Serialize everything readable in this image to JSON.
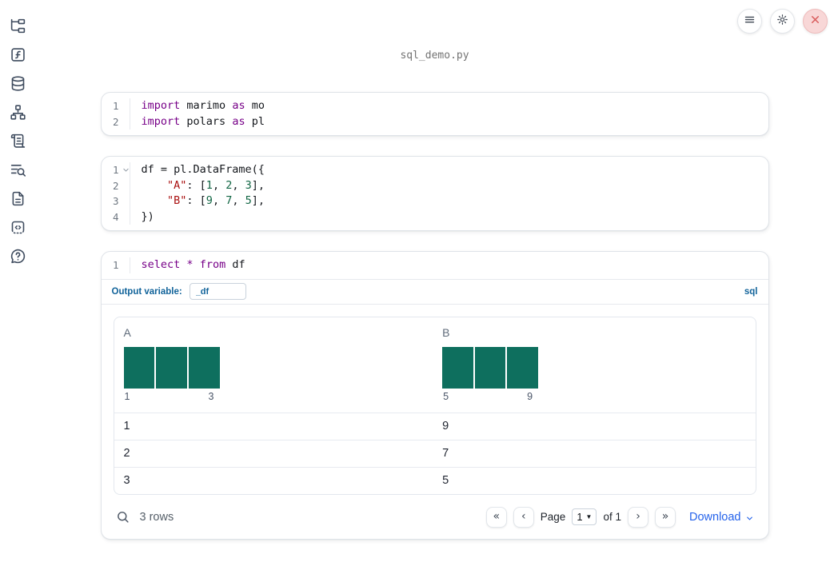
{
  "colors": {
    "keyword": "#770088",
    "string": "#aa1111",
    "number": "#116644",
    "bar": "#0e6f5e",
    "sql_accent": "#11639a",
    "download_link": "#2563eb",
    "close_red": "#d95b5b"
  },
  "sidebar": {
    "items": [
      {
        "name": "file-explorer",
        "icon": "folder-tree-icon"
      },
      {
        "name": "variables",
        "icon": "function-square-icon"
      },
      {
        "name": "data-sources",
        "icon": "database-icon"
      },
      {
        "name": "dependency-graph",
        "icon": "network-icon"
      },
      {
        "name": "logs",
        "icon": "scroll-text-icon"
      },
      {
        "name": "outline",
        "icon": "list-search-icon"
      },
      {
        "name": "documentation",
        "icon": "file-text-icon"
      },
      {
        "name": "snippets",
        "icon": "code-box-icon"
      },
      {
        "name": "help-chat",
        "icon": "message-question-icon"
      }
    ]
  },
  "titlebar": {
    "filename": "sql_demo.py",
    "buttons": [
      {
        "name": "menu",
        "icon": "hamburger-menu-icon"
      },
      {
        "name": "settings",
        "icon": "gear-icon"
      },
      {
        "name": "close",
        "icon": "close-icon"
      }
    ]
  },
  "cells": [
    {
      "type": "code",
      "lines": [
        {
          "n": "1",
          "tokens": [
            [
              "kw",
              "import"
            ],
            [
              "tx",
              " marimo "
            ],
            [
              "kw",
              "as"
            ],
            [
              "tx",
              " mo"
            ]
          ]
        },
        {
          "n": "2",
          "tokens": [
            [
              "kw",
              "import"
            ],
            [
              "tx",
              " polars "
            ],
            [
              "kw",
              "as"
            ],
            [
              "tx",
              " pl"
            ]
          ]
        }
      ]
    },
    {
      "type": "code",
      "lines": [
        {
          "n": "1",
          "fold": true,
          "tokens": [
            [
              "tx",
              "df = pl.DataFrame({"
            ]
          ]
        },
        {
          "n": "2",
          "tokens": [
            [
              "tx",
              "    "
            ],
            [
              "str",
              "\"A\""
            ],
            [
              "tx",
              ": ["
            ],
            [
              "num",
              "1"
            ],
            [
              "tx",
              ", "
            ],
            [
              "num",
              "2"
            ],
            [
              "tx",
              ", "
            ],
            [
              "num",
              "3"
            ],
            [
              "tx",
              "],"
            ]
          ]
        },
        {
          "n": "3",
          "tokens": [
            [
              "tx",
              "    "
            ],
            [
              "str",
              "\"B\""
            ],
            [
              "tx",
              ": ["
            ],
            [
              "num",
              "9"
            ],
            [
              "tx",
              ", "
            ],
            [
              "num",
              "7"
            ],
            [
              "tx",
              ", "
            ],
            [
              "num",
              "5"
            ],
            [
              "tx",
              "],"
            ]
          ]
        },
        {
          "n": "4",
          "tokens": [
            [
              "tx",
              "})"
            ]
          ]
        }
      ]
    },
    {
      "type": "sql",
      "lines": [
        {
          "n": "1",
          "tokens": [
            [
              "kw",
              "select"
            ],
            [
              "tx",
              " "
            ],
            [
              "kw",
              "*"
            ],
            [
              "tx",
              " "
            ],
            [
              "kw",
              "from"
            ],
            [
              "tx",
              " df"
            ]
          ]
        }
      ],
      "output_variable_label": "Output variable:",
      "output_variable_value": "_df",
      "language_badge": "sql"
    }
  ],
  "table": {
    "columns": [
      {
        "name": "A",
        "hist": {
          "bars": [
            1,
            1,
            1
          ],
          "min_label": "1",
          "max_label": "3"
        }
      },
      {
        "name": "B",
        "hist": {
          "bars": [
            1,
            1,
            1
          ],
          "min_label": "5",
          "max_label": "9"
        }
      }
    ],
    "rows": [
      [
        "1",
        "9"
      ],
      [
        "2",
        "7"
      ],
      [
        "3",
        "5"
      ]
    ],
    "footer": {
      "row_count": "3 rows",
      "page_label": "Page",
      "page_value": "1",
      "of_label": "of 1",
      "download_label": "Download"
    }
  }
}
